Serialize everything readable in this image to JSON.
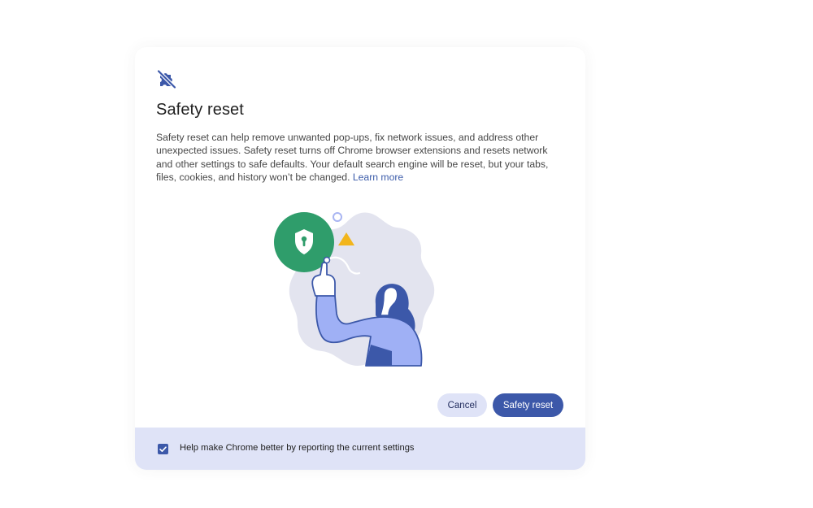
{
  "dialog": {
    "icon": "puzzle-off-icon",
    "title": "Safety reset",
    "body": "Safety reset can help remove unwanted pop-ups, fix network issues, and address other unexpected issues. Safety reset turns off Chrome browser extensions and resets network and other settings to safe defaults. Your default search engine will be reset, but your tabs, files, cookies, and history won’t be changed.",
    "learn_more": "Learn more",
    "illustration": "person-with-shield-illustration",
    "cancel_label": "Cancel",
    "reset_label": "Safety reset"
  },
  "footer": {
    "checkbox_checked": true,
    "checkbox_label": "Help make Chrome better by reporting the current settings"
  },
  "colors": {
    "accent": "#3c58a9",
    "tonal_button": "#dfe3f7",
    "shield_green": "#2f9d6b",
    "warning_yellow": "#f2b51c",
    "figure_blue": "#9fb0f5"
  }
}
